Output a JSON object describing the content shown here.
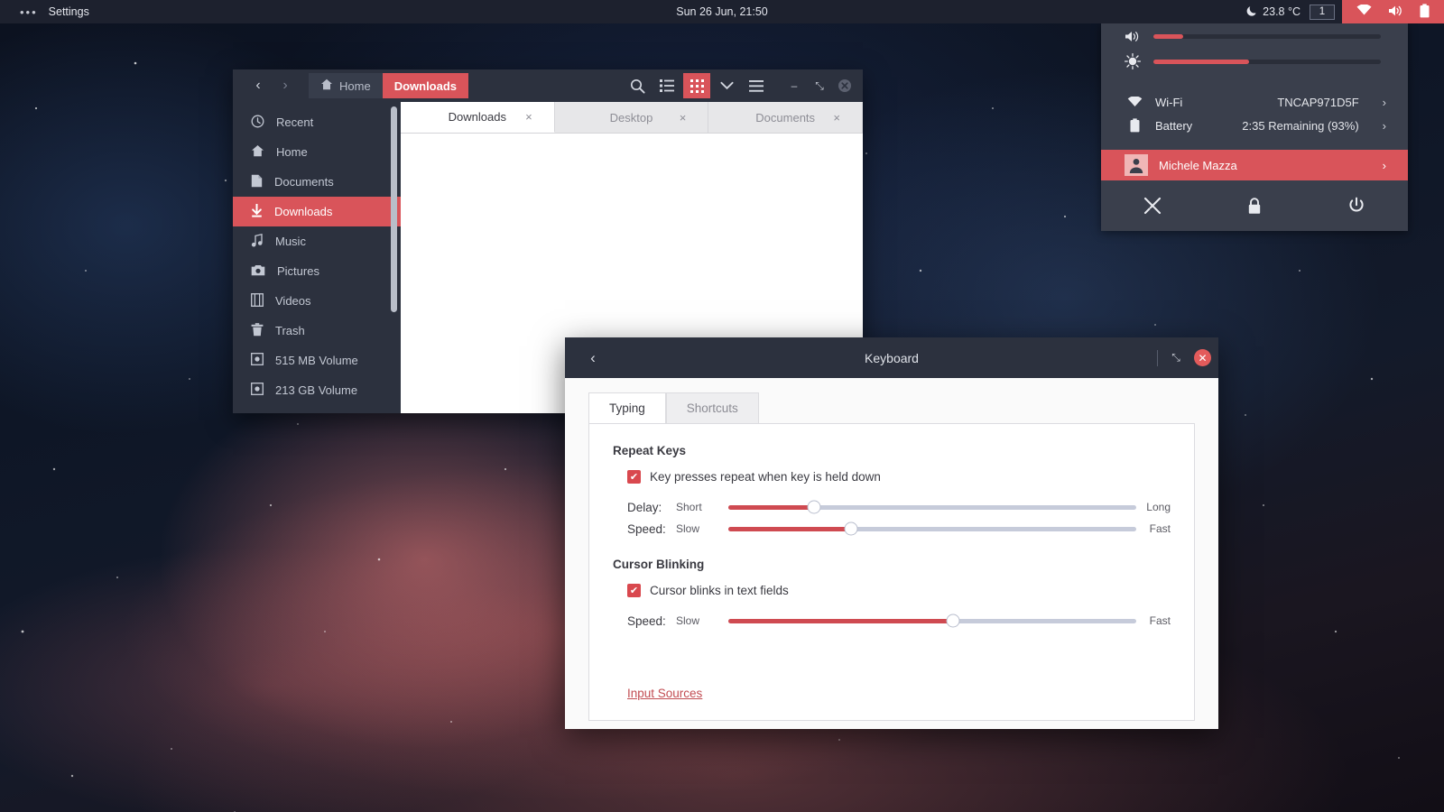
{
  "panel": {
    "menu_dots": "•••",
    "app_title": "Settings",
    "clock": "Sun 26 Jun, 21:50",
    "temperature": "23.8 °C",
    "workspace": "1",
    "icons": {
      "night_mode": "moon-icon",
      "wifi": "wifi-icon",
      "volume": "volume-icon",
      "battery": "battery-icon"
    }
  },
  "system_menu": {
    "volume": {
      "icon": "volume-icon",
      "value_percent": 13
    },
    "brightness": {
      "icon": "brightness-icon",
      "value_percent": 42
    },
    "rows": [
      {
        "icon": "wifi-icon",
        "label": "Wi-Fi",
        "value": "TNCAP971D5F",
        "chevron": "›"
      },
      {
        "icon": "battery-icon",
        "label": "Battery",
        "value": "2:35 Remaining (93%)",
        "chevron": "›"
      }
    ],
    "user": {
      "name": "Michele Mazza",
      "chevron": "›",
      "icon": "avatar-icon"
    },
    "actions": [
      {
        "name": "settings-tools",
        "icon": "tools-icon"
      },
      {
        "name": "lock-screen",
        "icon": "lock-icon"
      },
      {
        "name": "power",
        "icon": "power-icon"
      }
    ],
    "accent_color": "#d9545a",
    "background_color": "#3a3f4c"
  },
  "file_manager": {
    "nav": {
      "back": "‹",
      "forward": "›"
    },
    "breadcrumb": [
      {
        "label": "Home",
        "icon": "home-icon",
        "active": false
      },
      {
        "label": "Downloads",
        "icon": "",
        "active": true
      }
    ],
    "toolbar": [
      {
        "name": "search",
        "icon": "search-icon",
        "active": false
      },
      {
        "name": "list-view",
        "icon": "list-view-icon",
        "active": false
      },
      {
        "name": "grid-view",
        "icon": "grid-view-icon",
        "active": true
      },
      {
        "name": "view-options",
        "icon": "chevron-down-icon",
        "active": false
      },
      {
        "name": "menu",
        "icon": "hamburger-icon",
        "active": false
      }
    ],
    "window_buttons": {
      "minimize": "–",
      "maximize": "⤡",
      "close": "✕"
    },
    "sidebar": [
      {
        "label": "Recent",
        "icon": "clock-icon",
        "active": false
      },
      {
        "label": "Home",
        "icon": "home-icon",
        "active": false
      },
      {
        "label": "Documents",
        "icon": "document-icon",
        "active": false
      },
      {
        "label": "Downloads",
        "icon": "download-icon",
        "active": true
      },
      {
        "label": "Music",
        "icon": "music-note-icon",
        "active": false
      },
      {
        "label": "Pictures",
        "icon": "camera-icon",
        "active": false
      },
      {
        "label": "Videos",
        "icon": "film-icon",
        "active": false
      },
      {
        "label": "Trash",
        "icon": "trash-icon",
        "active": false
      },
      {
        "label": "515 MB Volume",
        "icon": "drive-icon",
        "active": false
      },
      {
        "label": "213 GB Volume",
        "icon": "drive-icon",
        "active": false
      }
    ],
    "tabs": [
      {
        "label": "Downloads",
        "close": "×",
        "active": true
      },
      {
        "label": "Desktop",
        "close": "×",
        "active": false
      },
      {
        "label": "Documents",
        "close": "×",
        "active": false
      }
    ]
  },
  "keyboard_dialog": {
    "title": "Keyboard",
    "back": "‹",
    "window_buttons": {
      "maximize": "⤡",
      "close": "✕"
    },
    "tabs": [
      {
        "label": "Typing",
        "active": true
      },
      {
        "label": "Shortcuts",
        "active": false
      }
    ],
    "sections": [
      {
        "title": "Repeat Keys",
        "checkbox": {
          "label": "Key presses repeat when key is held down",
          "checked": true,
          "mark": "✔"
        },
        "sliders": [
          {
            "label": "Delay:",
            "min_label": "Short",
            "max_label": "Long",
            "value_percent": 21
          },
          {
            "label": "Speed:",
            "min_label": "Slow",
            "max_label": "Fast",
            "value_percent": 30
          }
        ]
      },
      {
        "title": "Cursor Blinking",
        "checkbox": {
          "label": "Cursor blinks in text fields",
          "checked": true,
          "mark": "✔"
        },
        "sliders": [
          {
            "label": "Speed:",
            "min_label": "Slow",
            "max_label": "Fast",
            "value_percent": 55
          }
        ]
      }
    ],
    "link": "Input Sources"
  }
}
